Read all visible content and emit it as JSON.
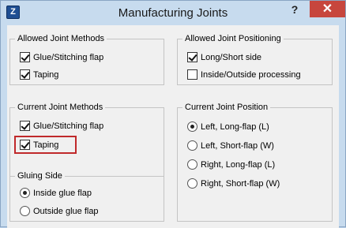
{
  "window": {
    "title": "Manufacturing Joints",
    "help_label": "?",
    "close_label": "✕",
    "app_icon_letter": "Z"
  },
  "allowed_methods": {
    "title": "Allowed Joint Methods",
    "options": [
      {
        "label": "Glue/Stitching flap",
        "checked": true
      },
      {
        "label": "Taping",
        "checked": true
      }
    ]
  },
  "allowed_positioning": {
    "title": "Allowed Joint Positioning",
    "options": [
      {
        "label": "Long/Short side",
        "checked": true
      },
      {
        "label": "Inside/Outside processing",
        "checked": false
      }
    ]
  },
  "current_methods": {
    "title": "Current Joint Methods",
    "options": [
      {
        "label": "Glue/Stitching flap",
        "checked": true
      },
      {
        "label": "Taping",
        "checked": true
      }
    ]
  },
  "current_position": {
    "title": "Current Joint Position",
    "options": [
      {
        "label": "Left, Long-flap (L)",
        "selected": true
      },
      {
        "label": "Left, Short-flap (W)",
        "selected": false
      },
      {
        "label": "Right, Long-flap (L)",
        "selected": false
      },
      {
        "label": "Right, Short-flap (W)",
        "selected": false
      }
    ]
  },
  "gluing_side": {
    "title": "Gluing Side",
    "options": [
      {
        "label": "Inside glue flap",
        "selected": true
      },
      {
        "label": "Outside glue flap",
        "selected": false
      }
    ]
  },
  "colors": {
    "frame": "#c7dbee",
    "close": "#c7463d",
    "highlight": "#c0292b"
  }
}
